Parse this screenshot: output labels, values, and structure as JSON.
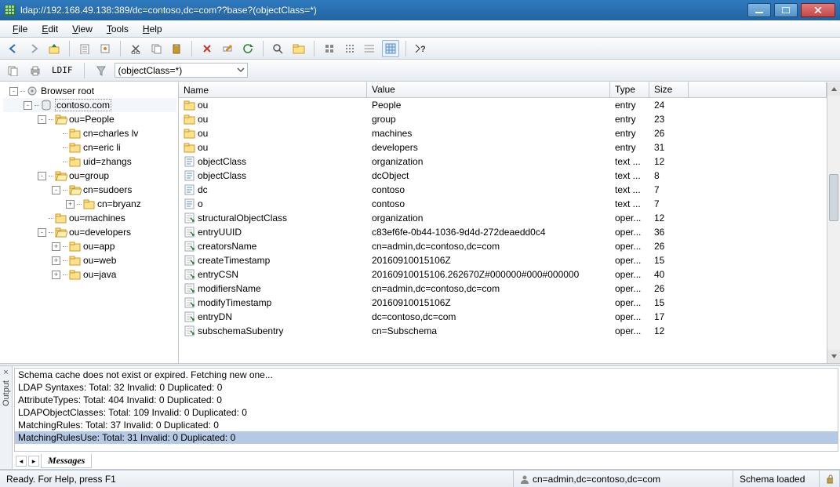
{
  "window": {
    "title": "ldap://192.168.49.138:389/dc=contoso,dc=com??base?(objectClass=*)"
  },
  "menu": {
    "file": "File",
    "edit": "Edit",
    "view": "View",
    "tools": "Tools",
    "help": "Help"
  },
  "toolbar2": {
    "ldif": "LDIF",
    "filter": "(objectClass=*)"
  },
  "tree": {
    "root": "Browser root",
    "items": [
      {
        "depth": 0,
        "tw": "-",
        "icon": "root",
        "label": "Browser root"
      },
      {
        "depth": 1,
        "tw": "-",
        "icon": "db",
        "label": "contoso.com",
        "sel": true
      },
      {
        "depth": 2,
        "tw": "-",
        "icon": "folder-open",
        "label": "ou=People"
      },
      {
        "depth": 3,
        "tw": " ",
        "icon": "folder",
        "label": "cn=charles lv"
      },
      {
        "depth": 3,
        "tw": " ",
        "icon": "folder",
        "label": "cn=eric li"
      },
      {
        "depth": 3,
        "tw": " ",
        "icon": "folder",
        "label": "uid=zhangs"
      },
      {
        "depth": 2,
        "tw": "-",
        "icon": "folder-open",
        "label": "ou=group"
      },
      {
        "depth": 3,
        "tw": "-",
        "icon": "folder-open",
        "label": "cn=sudoers"
      },
      {
        "depth": 4,
        "tw": "+",
        "icon": "folder",
        "label": "cn=bryanz"
      },
      {
        "depth": 2,
        "tw": " ",
        "icon": "folder",
        "label": "ou=machines"
      },
      {
        "depth": 2,
        "tw": "-",
        "icon": "folder-open",
        "label": "ou=developers"
      },
      {
        "depth": 3,
        "tw": "+",
        "icon": "folder",
        "label": "ou=app"
      },
      {
        "depth": 3,
        "tw": "+",
        "icon": "folder",
        "label": "ou=web"
      },
      {
        "depth": 3,
        "tw": "+",
        "icon": "folder",
        "label": "ou=java"
      }
    ]
  },
  "list": {
    "headers": {
      "name": "Name",
      "value": "Value",
      "type": "Type",
      "size": "Size"
    },
    "rows": [
      {
        "icon": "folder",
        "name": "ou",
        "value": "People",
        "type": "entry",
        "size": "24"
      },
      {
        "icon": "folder",
        "name": "ou",
        "value": "group",
        "type": "entry",
        "size": "23"
      },
      {
        "icon": "folder",
        "name": "ou",
        "value": "machines",
        "type": "entry",
        "size": "26"
      },
      {
        "icon": "folder",
        "name": "ou",
        "value": "developers",
        "type": "entry",
        "size": "31"
      },
      {
        "icon": "text",
        "name": "objectClass",
        "value": "organization",
        "type": "text ...",
        "size": "12"
      },
      {
        "icon": "text",
        "name": "objectClass",
        "value": "dcObject",
        "type": "text ...",
        "size": "8"
      },
      {
        "icon": "text",
        "name": "dc",
        "value": "contoso",
        "type": "text ...",
        "size": "7"
      },
      {
        "icon": "text",
        "name": "o",
        "value": "contoso",
        "type": "text ...",
        "size": "7"
      },
      {
        "icon": "oper",
        "name": "structuralObjectClass",
        "value": "organization",
        "type": "oper...",
        "size": "12"
      },
      {
        "icon": "oper",
        "name": "entryUUID",
        "value": "c83ef6fe-0b44-1036-9d4d-272deaedd0c4",
        "type": "oper...",
        "size": "36"
      },
      {
        "icon": "oper",
        "name": "creatorsName",
        "value": "cn=admin,dc=contoso,dc=com",
        "type": "oper...",
        "size": "26"
      },
      {
        "icon": "oper",
        "name": "createTimestamp",
        "value": "20160910015106Z",
        "type": "oper...",
        "size": "15"
      },
      {
        "icon": "oper",
        "name": "entryCSN",
        "value": "20160910015106.262670Z#000000#000#000000",
        "type": "oper...",
        "size": "40"
      },
      {
        "icon": "oper",
        "name": "modifiersName",
        "value": "cn=admin,dc=contoso,dc=com",
        "type": "oper...",
        "size": "26"
      },
      {
        "icon": "oper",
        "name": "modifyTimestamp",
        "value": "20160910015106Z",
        "type": "oper...",
        "size": "15"
      },
      {
        "icon": "oper",
        "name": "entryDN",
        "value": "dc=contoso,dc=com",
        "type": "oper...",
        "size": "17"
      },
      {
        "icon": "oper",
        "name": "subschemaSubentry",
        "value": "cn=Subschema",
        "type": "oper...",
        "size": "12"
      }
    ]
  },
  "output": {
    "title": "Output",
    "lines": [
      "Schema cache does not exist or expired. Fetching new one...",
      "LDAP Syntaxes:     Total: 32 Invalid: 0 Duplicated: 0",
      "AttributeTypes:     Total: 404 Invalid: 0 Duplicated: 0",
      "LDAPObjectClasses:     Total: 109 Invalid: 0 Duplicated: 0",
      "MatchingRules:     Total: 37 Invalid: 0 Duplicated: 0",
      "MatchingRulesUse:     Total: 31 Invalid: 0 Duplicated: 0"
    ],
    "selected": 5,
    "tab": "Messages"
  },
  "status": {
    "ready": "Ready. For Help, press F1",
    "user": "cn=admin,dc=contoso,dc=com",
    "schema": "Schema loaded"
  }
}
